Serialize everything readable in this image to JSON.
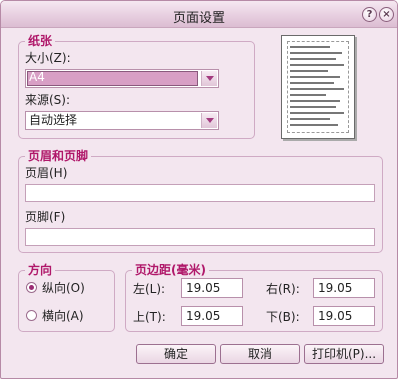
{
  "window": {
    "title": "页面设置"
  },
  "paper": {
    "group_label": "纸张",
    "size_label": "大小(Z):",
    "size_value": "A4",
    "source_label": "来源(S):",
    "source_value": "自动选择"
  },
  "header_footer": {
    "group_label": "页眉和页脚",
    "header_label": "页眉(H)",
    "header_value": "",
    "footer_label": "页脚(F)",
    "footer_value": ""
  },
  "orientation": {
    "group_label": "方向",
    "portrait_label": "纵向(O)",
    "landscape_label": "横向(A)",
    "selected": "portrait"
  },
  "margins": {
    "group_label": "页边距(毫米)",
    "left_label": "左(L):",
    "left_value": "19.05",
    "right_label": "右(R):",
    "right_value": "19.05",
    "top_label": "上(T):",
    "top_value": "19.05",
    "bottom_label": "下(B):",
    "bottom_value": "19.05"
  },
  "buttons": {
    "ok": "确定",
    "cancel": "取消",
    "printer": "打印机(P)..."
  },
  "icons": {
    "help": "help-icon",
    "close": "close-icon"
  },
  "colors": {
    "accent": "#b0186a",
    "window_bg": "#f3e6ef",
    "selection": "#d89fc5"
  }
}
